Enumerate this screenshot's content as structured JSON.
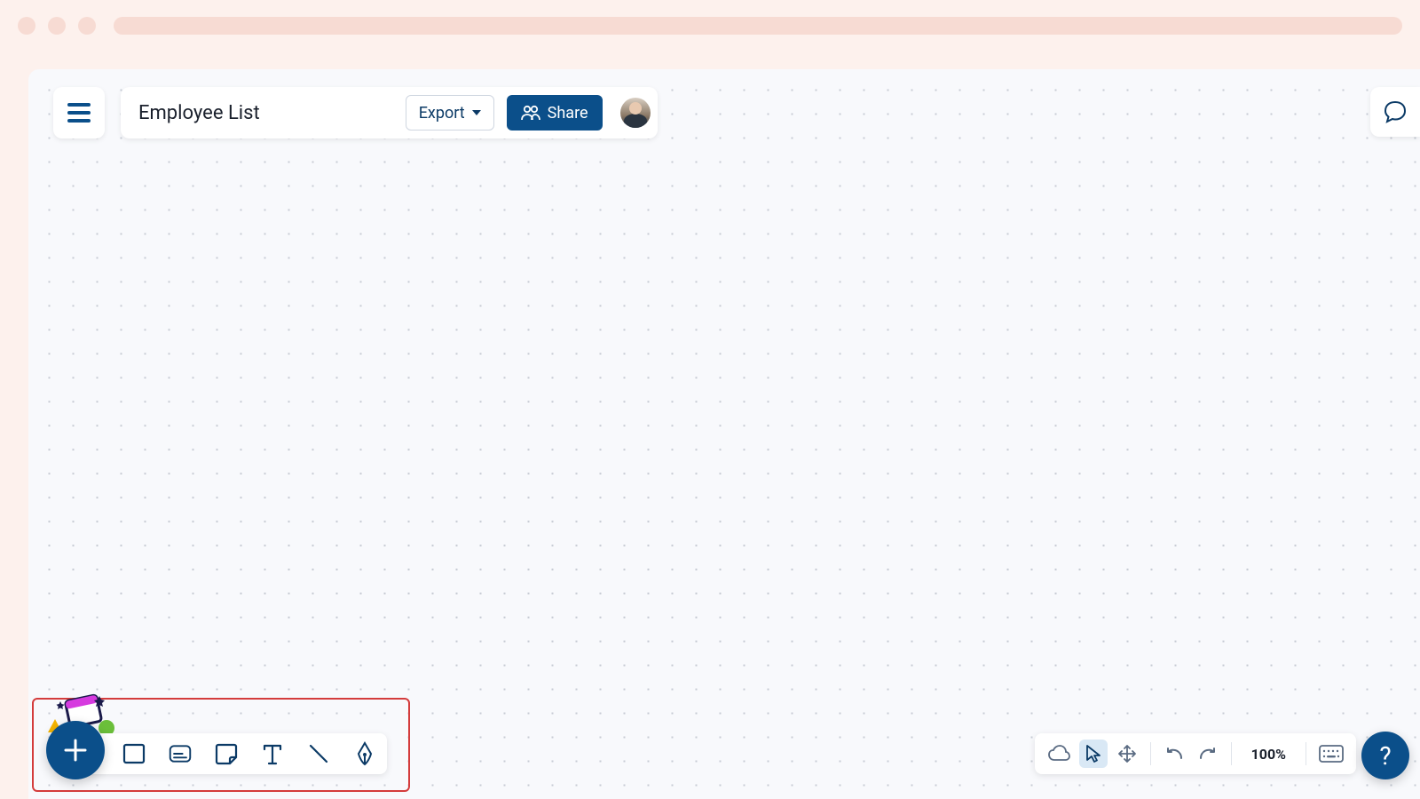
{
  "document": {
    "title": "Employee List"
  },
  "header": {
    "export_label": "Export",
    "share_label": "Share"
  },
  "toolbar_left": {
    "tools": [
      "add",
      "rectangle",
      "card",
      "note",
      "text",
      "line",
      "draw"
    ]
  },
  "toolbar_right": {
    "zoom": "100%"
  },
  "help": {
    "label": "?"
  }
}
